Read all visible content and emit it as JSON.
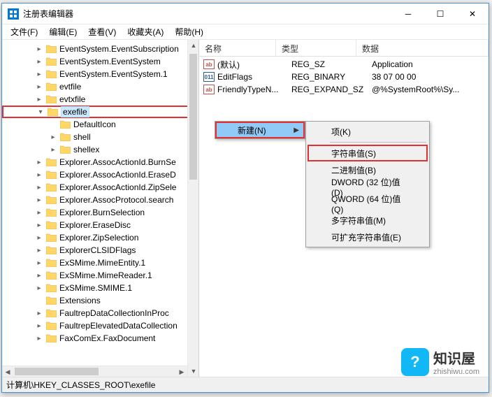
{
  "window": {
    "title": "注册表编辑器"
  },
  "menu": {
    "file": "文件(F)",
    "edit": "编辑(E)",
    "view": "查看(V)",
    "fav": "收藏夹(A)",
    "help": "帮助(H)"
  },
  "tree": {
    "items": [
      {
        "indent": 46,
        "exp": "▸",
        "label": "EventSystem.EventSubscription"
      },
      {
        "indent": 46,
        "exp": "▸",
        "label": "EventSystem.EventSystem"
      },
      {
        "indent": 46,
        "exp": "▸",
        "label": "EventSystem.EventSystem.1"
      },
      {
        "indent": 46,
        "exp": "▸",
        "label": "evtfile"
      },
      {
        "indent": 46,
        "exp": "▸",
        "label": "evtxfile"
      },
      {
        "indent": 46,
        "exp": "▾",
        "label": "exefile",
        "highlight": true,
        "selected": true
      },
      {
        "indent": 66,
        "exp": "",
        "label": "DefaultIcon"
      },
      {
        "indent": 66,
        "exp": "▸",
        "label": "shell"
      },
      {
        "indent": 66,
        "exp": "▸",
        "label": "shellex"
      },
      {
        "indent": 46,
        "exp": "▸",
        "label": "Explorer.AssocActionId.BurnSe"
      },
      {
        "indent": 46,
        "exp": "▸",
        "label": "Explorer.AssocActionId.EraseD"
      },
      {
        "indent": 46,
        "exp": "▸",
        "label": "Explorer.AssocActionId.ZipSele"
      },
      {
        "indent": 46,
        "exp": "▸",
        "label": "Explorer.AssocProtocol.search"
      },
      {
        "indent": 46,
        "exp": "▸",
        "label": "Explorer.BurnSelection"
      },
      {
        "indent": 46,
        "exp": "▸",
        "label": "Explorer.EraseDisc"
      },
      {
        "indent": 46,
        "exp": "▸",
        "label": "Explorer.ZipSelection"
      },
      {
        "indent": 46,
        "exp": "▸",
        "label": "ExplorerCLSIDFlags"
      },
      {
        "indent": 46,
        "exp": "▸",
        "label": "ExSMime.MimeEntity.1"
      },
      {
        "indent": 46,
        "exp": "▸",
        "label": "ExSMime.MimeReader.1"
      },
      {
        "indent": 46,
        "exp": "▸",
        "label": "ExSMime.SMIME.1"
      },
      {
        "indent": 46,
        "exp": "",
        "label": "Extensions"
      },
      {
        "indent": 46,
        "exp": "▸",
        "label": "FaultrepDataCollectionInProc"
      },
      {
        "indent": 46,
        "exp": "▸",
        "label": "FaultrepElevatedDataCollection"
      },
      {
        "indent": 46,
        "exp": "▸",
        "label": "FaxComEx.FaxDocument"
      }
    ]
  },
  "list": {
    "headers": {
      "name": "名称",
      "type": "类型",
      "data": "数据"
    },
    "rows": [
      {
        "icon": "ab",
        "name": "(默认)",
        "type": "REG_SZ",
        "data": "Application"
      },
      {
        "icon": "bin",
        "name": "EditFlags",
        "type": "REG_BINARY",
        "data": "38 07 00 00"
      },
      {
        "icon": "ab",
        "name": "FriendlyTypeN...",
        "type": "REG_EXPAND_SZ",
        "data": "@%SystemRoot%\\Sy..."
      }
    ]
  },
  "ctx1": {
    "new": "新建(N)"
  },
  "ctx2": {
    "key": "项(K)",
    "string": "字符串值(S)",
    "binary": "二进制值(B)",
    "dword": "DWORD (32 位)值(D)",
    "qword": "QWORD (64 位)值(Q)",
    "multi": "多字符串值(M)",
    "expand": "可扩充字符串值(E)"
  },
  "status": {
    "path": "计算机\\HKEY_CLASSES_ROOT\\exefile"
  },
  "watermark": {
    "title": "知识屋",
    "url": "zhishiwu.com",
    "icon": "?"
  }
}
